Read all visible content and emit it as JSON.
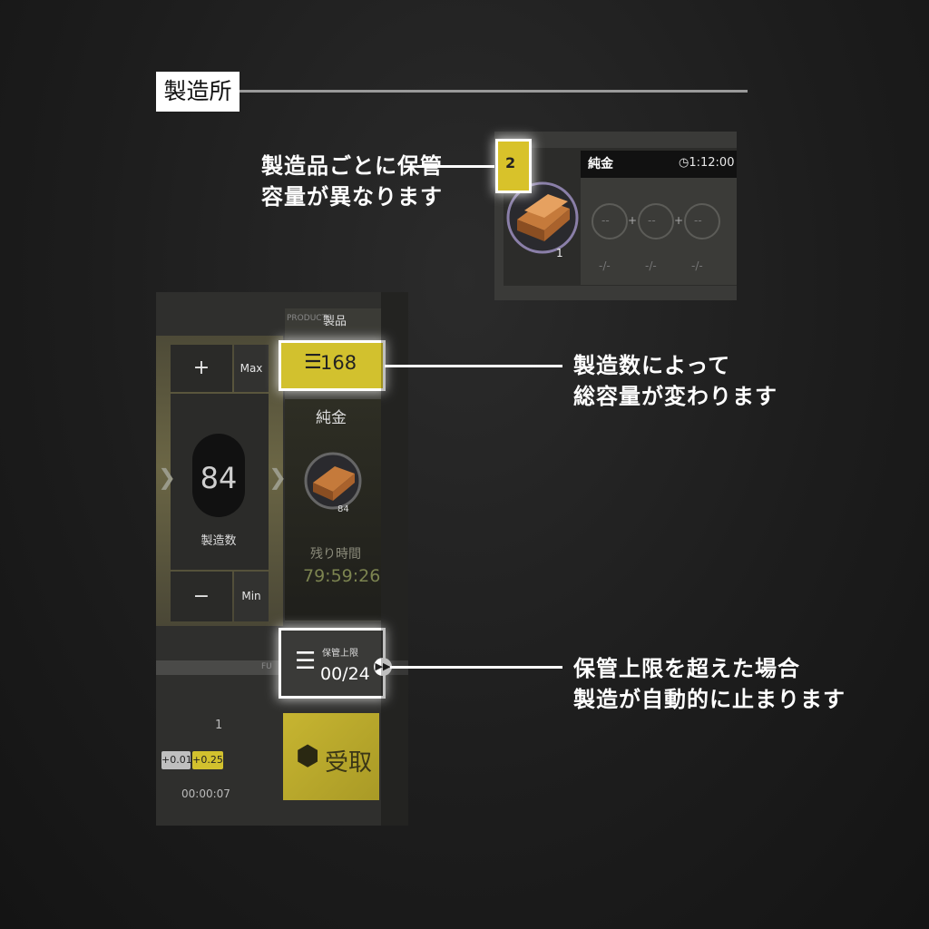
{
  "section": {
    "title": "製造所"
  },
  "callouts": {
    "storage_per_product": {
      "line1": "製造品ごとに保管",
      "line2": "容量が異なります"
    },
    "capacity_by_count": {
      "line1": "製造数によって",
      "line2": "総容量が変わります"
    },
    "auto_stop": {
      "line1": "保管上限を超えた場合",
      "line2": "製造が自動的に止まります"
    }
  },
  "product_card": {
    "name": "純金",
    "time": "1:12:00",
    "badge": "2",
    "item_count": "1",
    "slots": [
      "--",
      "--",
      "--"
    ],
    "slot_values": [
      "-/-",
      "-/-",
      "-/-"
    ],
    "plus_sign": "+"
  },
  "production_panel": {
    "plus_label": "+",
    "max_label": "Max",
    "count": "84",
    "count_label": "製造数",
    "minus_label": "−",
    "min_label": "Min",
    "products_label_en": "PRODUCTS",
    "products_label": "製品",
    "capacity_value": "168",
    "product_name": "純金",
    "product_qty": "84",
    "remaining_label": "残り時間",
    "remaining_time": "79:59:26",
    "storage_label": "保管上限",
    "storage_value": "00/24",
    "receive_label": "受取",
    "left_number": "1",
    "rate_tag_1": "+0.01",
    "rate_tag_2": "+0.25",
    "left_timer": "00:00:07",
    "strip_label": "FU"
  },
  "colors": {
    "accent_yellow": "#d2c12e",
    "background": "#1f1f1f",
    "highlight": "#ffffff"
  }
}
